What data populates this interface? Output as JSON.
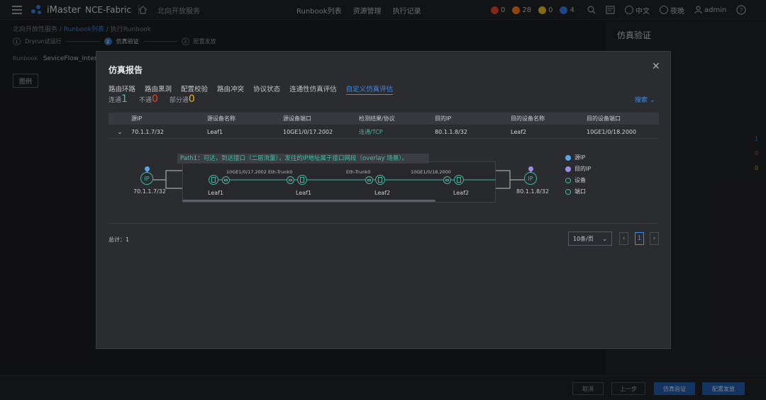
{
  "topbar": {
    "app_prefix": "iMaster",
    "app_name": "NCE-Fabric",
    "breadcrumb": "北向开放服务",
    "nav": [
      "Runbook列表",
      "资源管理",
      "执行记录"
    ],
    "alarms": [
      {
        "value": "0",
        "color": "#e0452f"
      },
      {
        "value": "28",
        "color": "#ef7a1a"
      },
      {
        "value": "0",
        "color": "#e8b51b"
      },
      {
        "value": "4",
        "color": "#2f7de1"
      }
    ],
    "language": "中文",
    "theme": "夜晚",
    "user": "admin"
  },
  "page": {
    "crumbs_prefix": "北向开放性服务 / ",
    "crumbs_link": "Runbook列表",
    "crumbs_suffix": " / 执行Runbook",
    "steps": [
      {
        "num": "1",
        "label": "Dryrun试运行"
      },
      {
        "num": "2",
        "label": "仿真验证"
      },
      {
        "num": "3",
        "label": "配置发放"
      }
    ],
    "runbook_label": "Runbook",
    "runbook_value": "SeviceFlow_Inter_",
    "legend_button": "图例",
    "right_panel_title": "仿真验证",
    "side_numbers": [
      "1",
      "0",
      "0"
    ],
    "bottom_buttons": [
      "取消",
      "上一步",
      "仿真验证",
      "配置发放"
    ]
  },
  "modal": {
    "title": "仿真报告",
    "tabs": [
      "路由环路",
      "路由黑洞",
      "配置校验",
      "路由冲突",
      "协议状态",
      "连通性仿真评估",
      "自定义仿真评估"
    ],
    "summary": {
      "connected_label": "连通",
      "connected": "1",
      "blocked_label": "不通",
      "blocked": "0",
      "partial_label": "部分通",
      "partial": "0"
    },
    "search": "搜索",
    "columns": [
      "源IP",
      "源设备名称",
      "源设备端口",
      "检测结果/协议",
      "目的IP",
      "目的设备名称",
      "目的设备端口"
    ],
    "row": [
      "70.1.1.7/32",
      "Leaf1",
      "10GE1/0/17.2002",
      "连通/TCP",
      "80.1.1.8/32",
      "Leaf2",
      "10GE1/0/18.2000"
    ],
    "topology": {
      "tooltip": "Path1：可达，到达接口（二层流量），发往的IP地址属于接口网段（overlay 场景）。",
      "src_ip": "70.1.1.7/32",
      "dst_ip": "80.1.1.8/32",
      "ip_text": "IP",
      "ports": [
        "10GE1/0/17.2002",
        "Eth-Trunk0",
        "Eth-Trunk0",
        "10GE1/0/18.2000"
      ],
      "devices": [
        "Leaf1",
        "Leaf1",
        "Leaf2",
        "Leaf2"
      ]
    },
    "legend": [
      "源IP",
      "目的IP",
      "设备",
      "端口"
    ],
    "total": "总计：1",
    "page_size": "10条/页",
    "current_page": "1"
  }
}
